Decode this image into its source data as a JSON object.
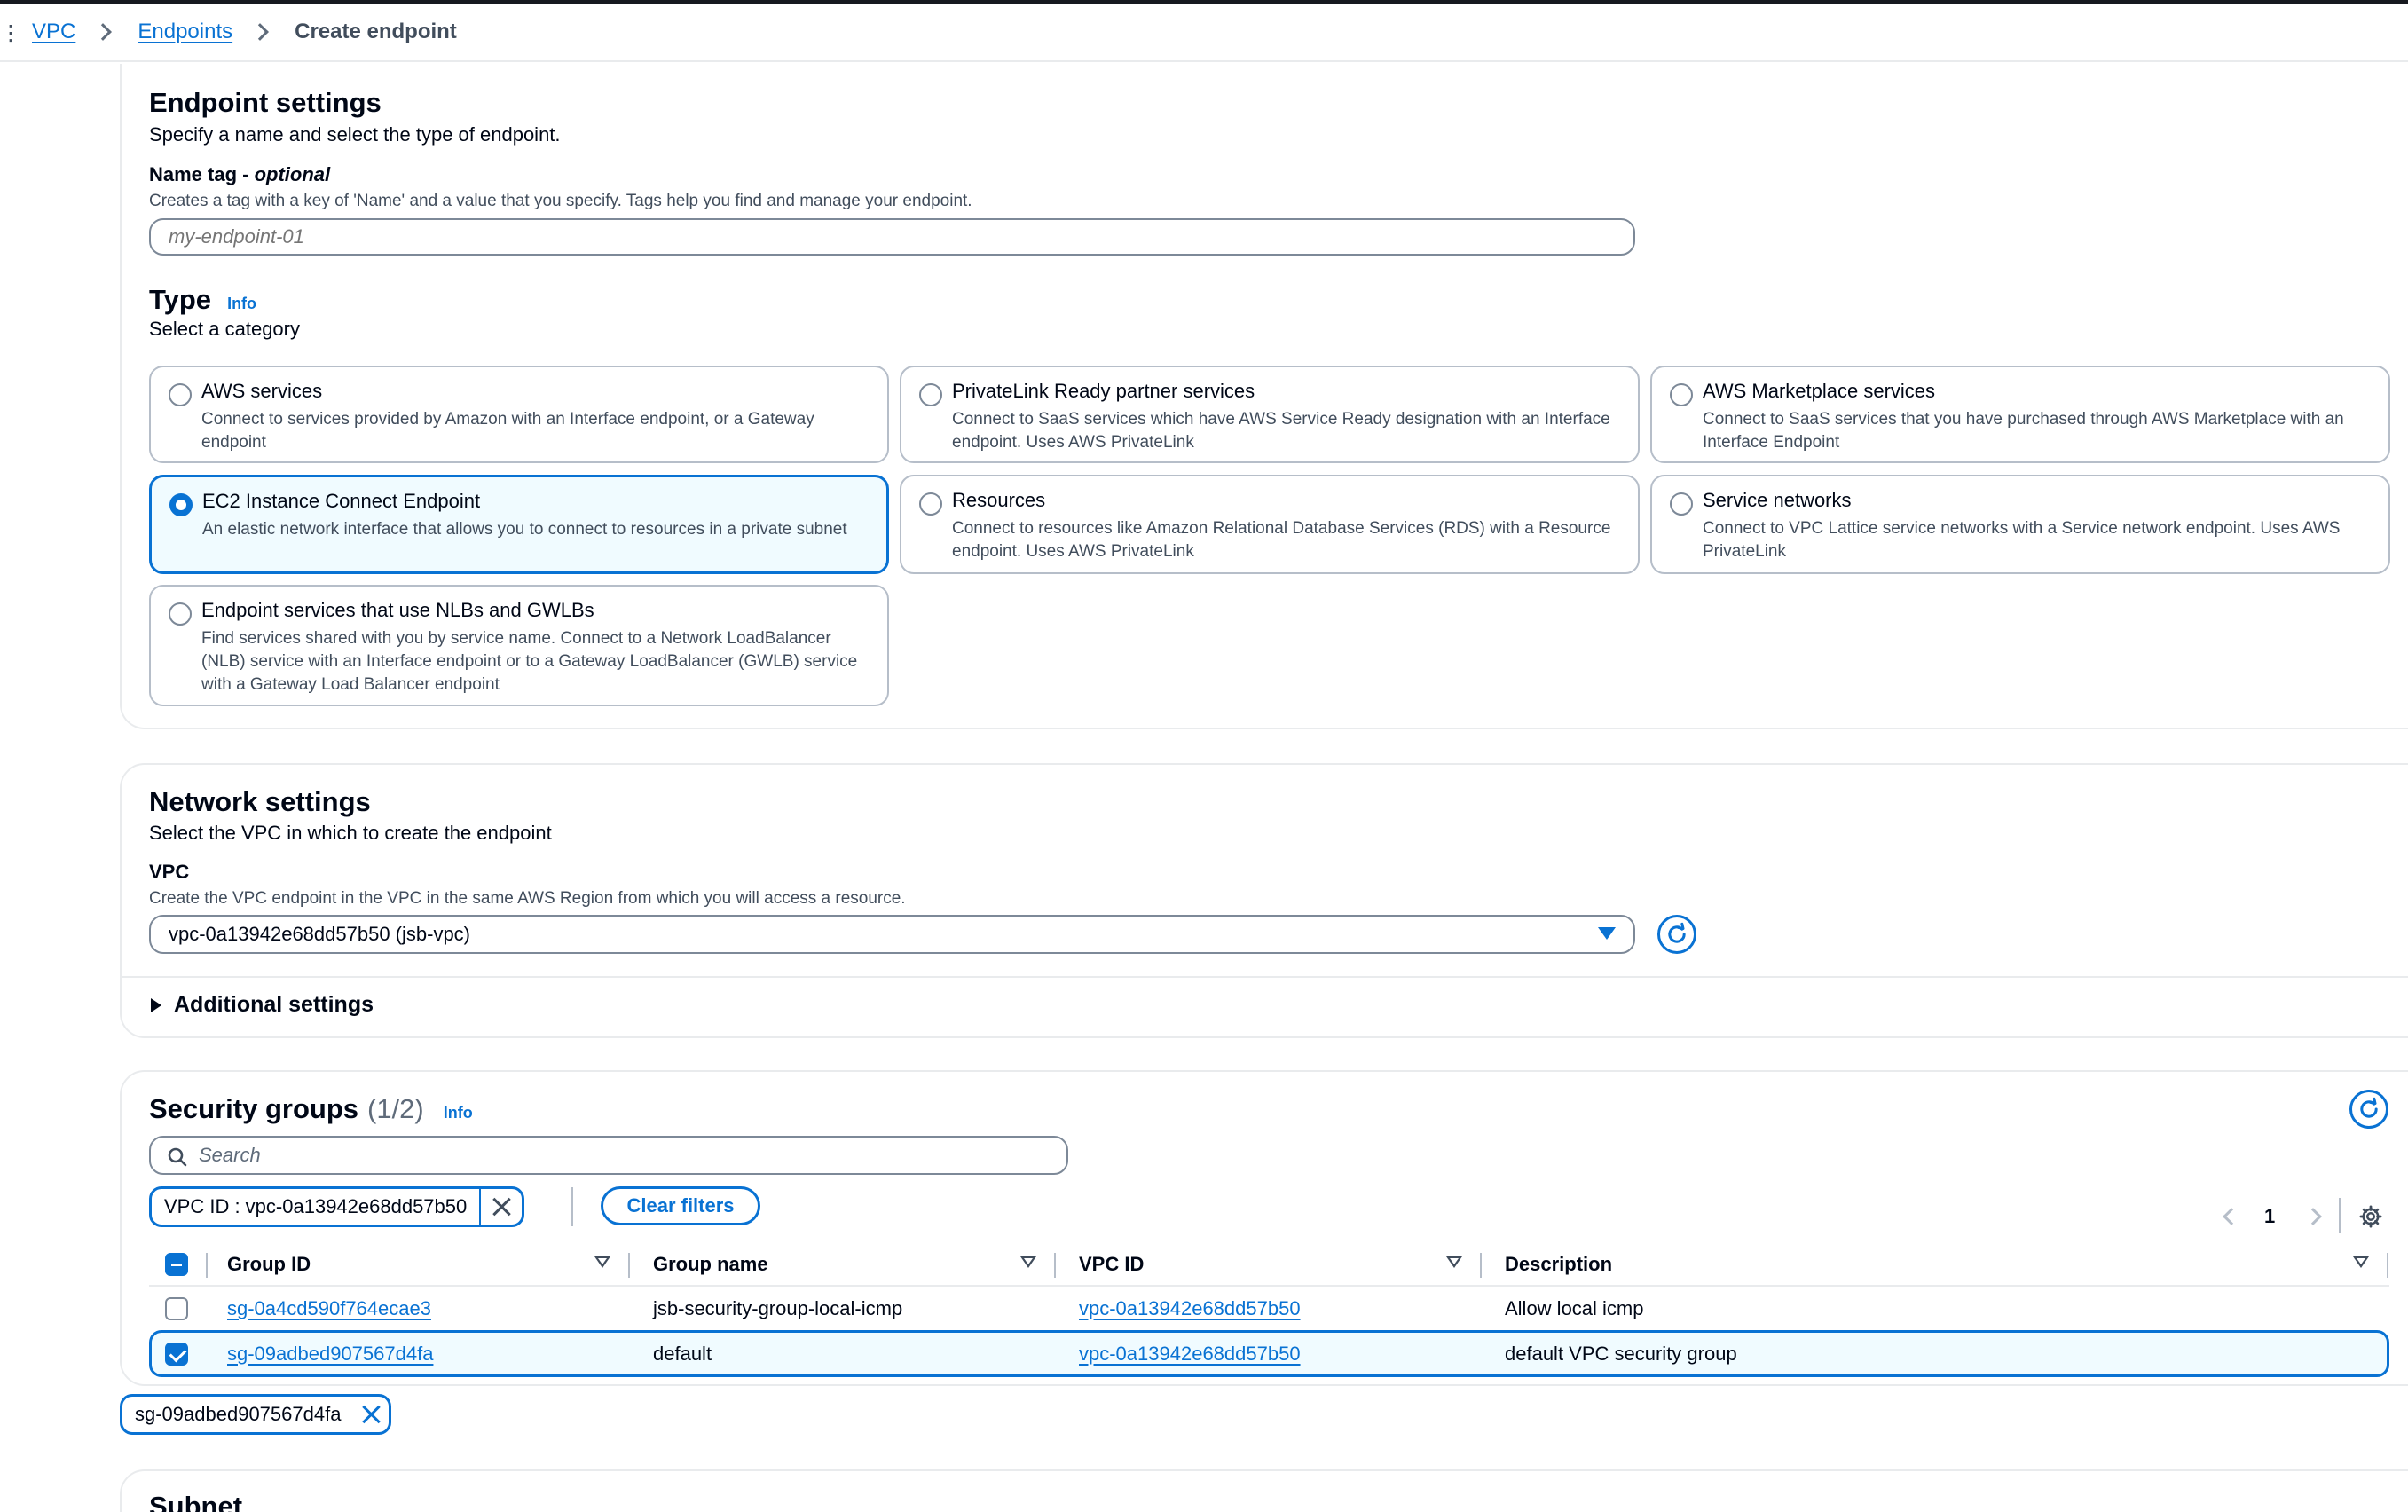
{
  "breadcrumb": {
    "items": [
      "VPC",
      "Endpoints"
    ],
    "current": "Create endpoint"
  },
  "endpoint_settings": {
    "title": "Endpoint settings",
    "subtitle": "Specify a name and select the type of endpoint.",
    "name_tag": {
      "label": "Name tag - ",
      "label_optional": "optional",
      "description": "Creates a tag with a key of 'Name' and a value that you specify. Tags help you find and manage your endpoint.",
      "placeholder": "my-endpoint-01",
      "value": ""
    },
    "type": {
      "label": "Type",
      "info": "Info",
      "subtitle": "Select a category",
      "selected_index": 3,
      "options": [
        {
          "title": "AWS services",
          "description": "Connect to services provided by Amazon with an Interface endpoint, or a Gateway endpoint"
        },
        {
          "title": "PrivateLink Ready partner services",
          "description": "Connect to SaaS services which have AWS Service Ready designation with an Interface endpoint. Uses AWS PrivateLink"
        },
        {
          "title": "AWS Marketplace services",
          "description": "Connect to SaaS services that you have purchased through AWS Marketplace with an Interface Endpoint"
        },
        {
          "title": "EC2 Instance Connect Endpoint",
          "description": "An elastic network interface that allows you to connect to resources in a private subnet"
        },
        {
          "title": "Resources",
          "description": "Connect to resources like Amazon Relational Database Services (RDS) with a Resource endpoint. Uses AWS PrivateLink"
        },
        {
          "title": "Service networks",
          "description": "Connect to VPC Lattice service networks with a Service network endpoint. Uses AWS PrivateLink"
        },
        {
          "title": "Endpoint services that use NLBs and GWLBs",
          "description": "Find services shared with you by service name. Connect to a Network LoadBalancer (NLB) service with an Interface endpoint or to a Gateway LoadBalancer (GWLB) service with a Gateway Load Balancer endpoint"
        }
      ]
    }
  },
  "network_settings": {
    "title": "Network settings",
    "subtitle": "Select the VPC in which to create the endpoint",
    "vpc_label": "VPC",
    "vpc_description": "Create the VPC endpoint in the VPC in the same AWS Region from which you will access a resource.",
    "vpc_value": "vpc-0a13942e68dd57b50 (jsb-vpc)",
    "additional_settings": "Additional settings"
  },
  "security_groups": {
    "title": "Security groups",
    "count": "(1/2)",
    "info": "Info",
    "search_placeholder": "Search",
    "filter_token": "VPC ID : vpc-0a13942e68dd57b50",
    "clear_filters": "Clear filters",
    "page": "1",
    "columns": [
      "Group ID",
      "Group name",
      "VPC ID",
      "Description"
    ],
    "rows": [
      {
        "group_id": "sg-0a4cd590f764ecae3",
        "group_name": "jsb-security-group-local-icmp",
        "vpc_id": "vpc-0a13942e68dd57b50",
        "description": "Allow local icmp",
        "selected": false
      },
      {
        "group_id": "sg-09adbed907567d4fa",
        "group_name": "default",
        "vpc_id": "vpc-0a13942e68dd57b50",
        "description": "default VPC security group",
        "selected": true
      }
    ],
    "selected_token": "sg-09adbed907567d4fa"
  },
  "subnet": {
    "title": "Subnet"
  }
}
